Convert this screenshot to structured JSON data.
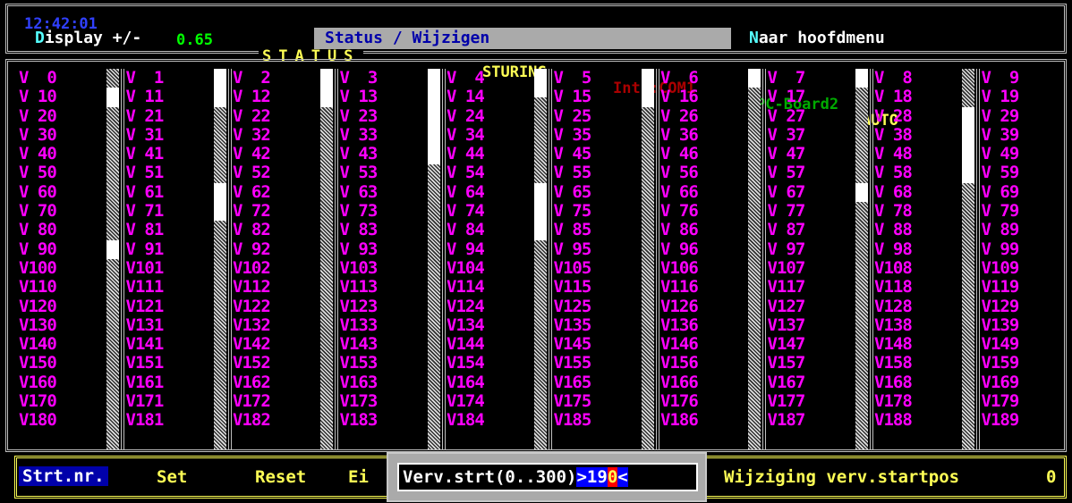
{
  "header": {
    "time": "12:42:01",
    "value": "0.65",
    "status": "STATUS",
    "sturing": "STURING",
    "interface": "Int1:COM1",
    "board": "PC-Board2",
    "mode": "AUTO",
    "display_hot": "D",
    "display_rest": "isplay +/-",
    "status_menu": "Status / Wijzigen",
    "naar_hot": "N",
    "naar_rest": "aar hoofdmenu"
  },
  "grid": {
    "columns": [
      {
        "cells": [
          "V  0",
          "V 10",
          "V 20",
          "V 30",
          "V 40",
          "V 50",
          "V 60",
          "V 70",
          "V 80",
          "V 90",
          "V100",
          "V110",
          "V120",
          "V130",
          "V140",
          "V150",
          "V160",
          "V170",
          "V180"
        ],
        "thumbs": [
          [
            21.3,
            42.6
          ],
          [
            191.7,
            213
          ]
        ]
      },
      {
        "cells": [
          "V  1",
          "V 11",
          "V 21",
          "V 31",
          "V 41",
          "V 51",
          "V 61",
          "V 71",
          "V 81",
          "V 91",
          "V101",
          "V111",
          "V121",
          "V131",
          "V141",
          "V151",
          "V161",
          "V171",
          "V181"
        ],
        "thumbs": [
          [
            0,
            42.6
          ],
          [
            127.8,
            170.4
          ]
        ]
      },
      {
        "cells": [
          "V  2",
          "V 12",
          "V 22",
          "V 32",
          "V 42",
          "V 52",
          "V 62",
          "V 72",
          "V 82",
          "V 92",
          "V102",
          "V112",
          "V122",
          "V132",
          "V142",
          "V152",
          "V162",
          "V172",
          "V182"
        ],
        "thumbs": [
          [
            0,
            42.6
          ]
        ]
      },
      {
        "cells": [
          "V  3",
          "V 13",
          "V 23",
          "V 33",
          "V 43",
          "V 53",
          "V 63",
          "V 73",
          "V 83",
          "V 93",
          "V103",
          "V113",
          "V123",
          "V133",
          "V143",
          "V153",
          "V163",
          "V173",
          "V183"
        ],
        "thumbs": [
          [
            0,
            106.5
          ]
        ]
      },
      {
        "cells": [
          "V  4",
          "V 14",
          "V 24",
          "V 34",
          "V 44",
          "V 54",
          "V 64",
          "V 74",
          "V 84",
          "V 94",
          "V104",
          "V114",
          "V124",
          "V134",
          "V144",
          "V154",
          "V164",
          "V174",
          "V184"
        ],
        "thumbs": [
          [
            0,
            31.95
          ],
          [
            127.8,
            191.7
          ]
        ]
      },
      {
        "cells": [
          "V  5",
          "V 15",
          "V 25",
          "V 35",
          "V 45",
          "V 55",
          "V 65",
          "V 75",
          "V 85",
          "V 95",
          "V105",
          "V115",
          "V125",
          "V135",
          "V145",
          "V155",
          "V165",
          "V175",
          "V185"
        ],
        "thumbs": [
          [
            0,
            42.6
          ]
        ]
      },
      {
        "cells": [
          "V  6",
          "V 16",
          "V 26",
          "V 36",
          "V 46",
          "V 56",
          "V 66",
          "V 76",
          "V 86",
          "V 96",
          "V106",
          "V116",
          "V126",
          "V136",
          "V146",
          "V156",
          "V166",
          "V176",
          "V186"
        ],
        "thumbs": [
          [
            0,
            21.3
          ]
        ]
      },
      {
        "cells": [
          "V  7",
          "V 17",
          "V 27",
          "V 37",
          "V 47",
          "V 57",
          "V 67",
          "V 77",
          "V 87",
          "V 97",
          "V107",
          "V117",
          "V127",
          "V137",
          "V147",
          "V157",
          "V167",
          "V177",
          "V187"
        ],
        "thumbs": [
          [
            0,
            21.3
          ],
          [
            127.8,
            149.1
          ]
        ]
      },
      {
        "cells": [
          "V  8",
          "V 18",
          "V 28",
          "V 38",
          "V 48",
          "V 58",
          "V 68",
          "V 78",
          "V 88",
          "V 98",
          "V108",
          "V118",
          "V128",
          "V138",
          "V148",
          "V158",
          "V168",
          "V178",
          "V188"
        ],
        "thumbs": [
          [
            42.6,
            127.8
          ]
        ]
      },
      {
        "cells": [
          "V  9",
          "V 19",
          "V 29",
          "V 39",
          "V 49",
          "V 59",
          "V 69",
          "V 79",
          "V 89",
          "V 99",
          "V109",
          "V119",
          "V129",
          "V139",
          "V149",
          "V159",
          "V169",
          "V179",
          "V189"
        ],
        "thumbs": [
          [
            149.1,
            170.4
          ],
          [
            191.7,
            213
          ]
        ]
      }
    ]
  },
  "footer": {
    "strt_label": "Strt.nr.",
    "set_label": "Set",
    "reset_label": "Reset",
    "ei_label": "Ei",
    "message": "Wijziging verv.startpos",
    "count": "0"
  },
  "popup": {
    "prompt": "Verv.strt(0..300)",
    "open_marker": ">",
    "input_value": "19",
    "cursor_char": "0",
    "close_marker": "<"
  }
}
